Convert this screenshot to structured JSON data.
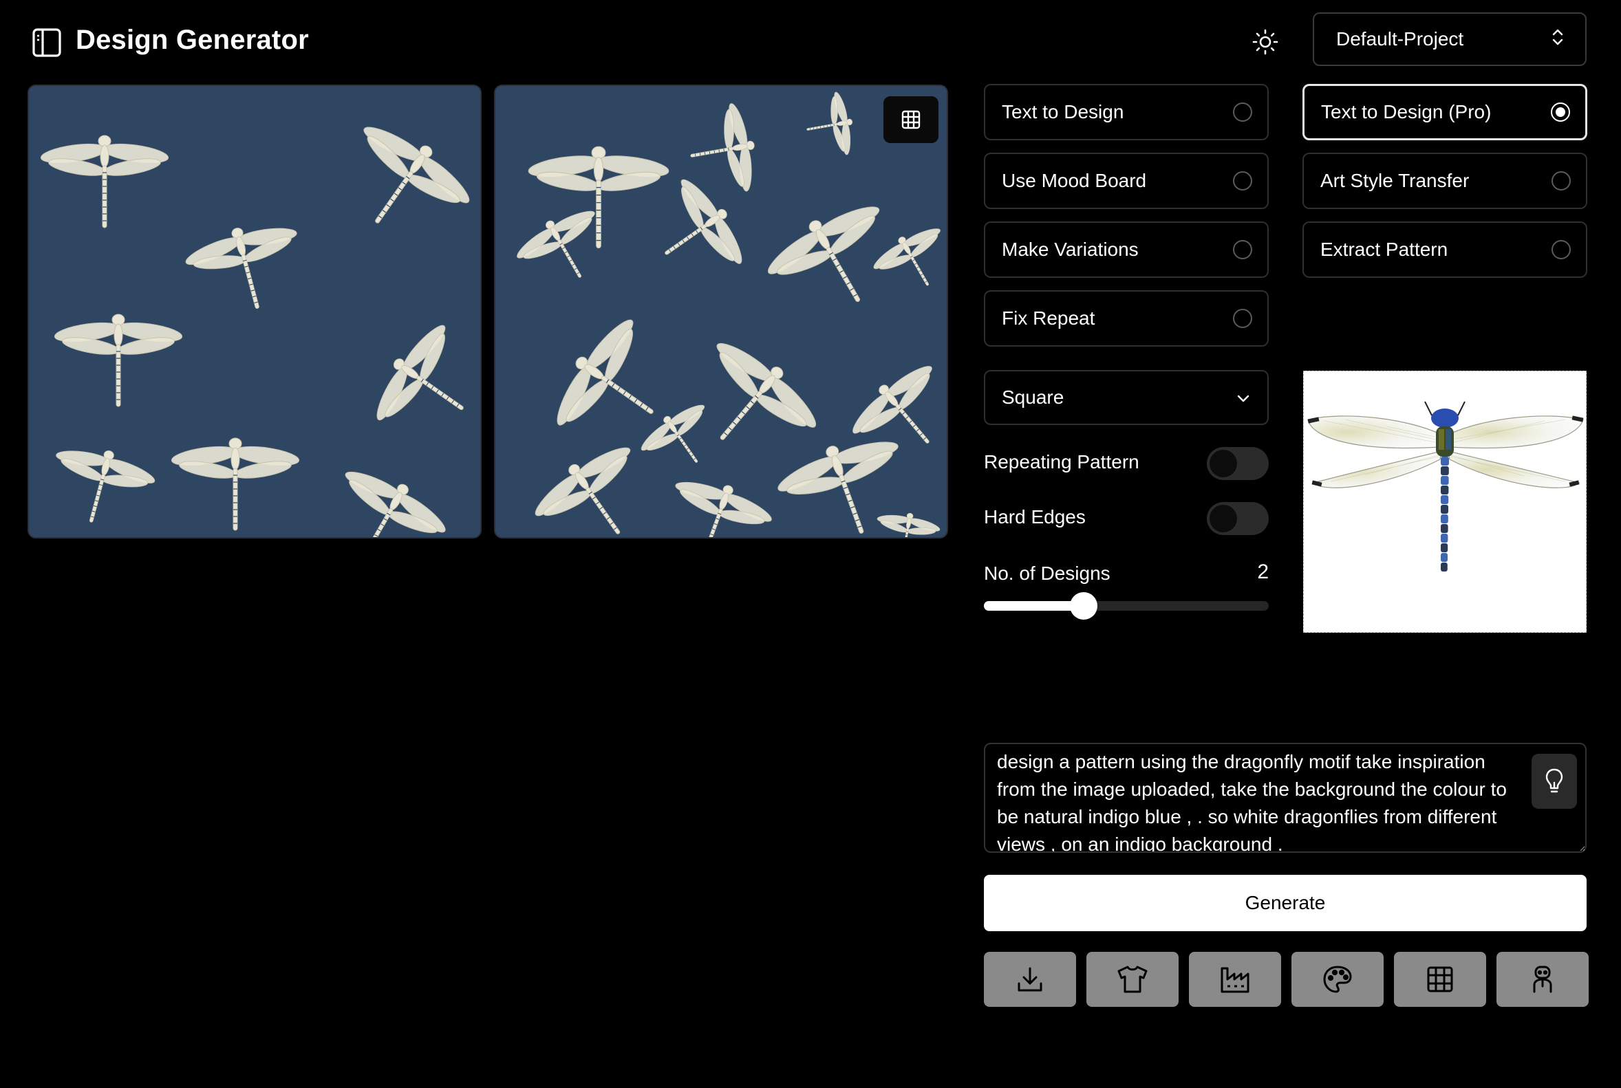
{
  "header": {
    "title": "Design Generator",
    "project": "Default-Project"
  },
  "modes": {
    "left": [
      {
        "label": "Text to Design",
        "selected": false
      },
      {
        "label": "Use Mood Board",
        "selected": false
      },
      {
        "label": "Make Variations",
        "selected": false
      },
      {
        "label": "Fix Repeat",
        "selected": false
      }
    ],
    "right": [
      {
        "label": "Text to Design (Pro)",
        "selected": true
      },
      {
        "label": "Art Style Transfer",
        "selected": false
      },
      {
        "label": "Extract Pattern",
        "selected": false
      }
    ]
  },
  "aspect": {
    "value": "Square"
  },
  "toggles": {
    "repeating_pattern": {
      "label": "Repeating Pattern",
      "on": false
    },
    "hard_edges": {
      "label": "Hard Edges",
      "on": false
    }
  },
  "designs_count": {
    "label": "No. of Designs",
    "value": "2",
    "slider_fraction": 0.35
  },
  "prompt": {
    "text": "design a pattern using the dragonfly motif take inspiration from the image uploaded, take the background the colour to be natural indigo blue , . so white dragonflies from different views , on an indigo background ."
  },
  "generate_label": "Generate",
  "action_icons": [
    "download-icon",
    "shirt-icon",
    "factory-icon",
    "palette-icon",
    "grid-icon",
    "mannequin-icon"
  ],
  "colors": {
    "background": "#000000",
    "indigo": "#2f4663",
    "dragonfly": "#e9e6d6",
    "action_button": "#8a8a8a"
  }
}
